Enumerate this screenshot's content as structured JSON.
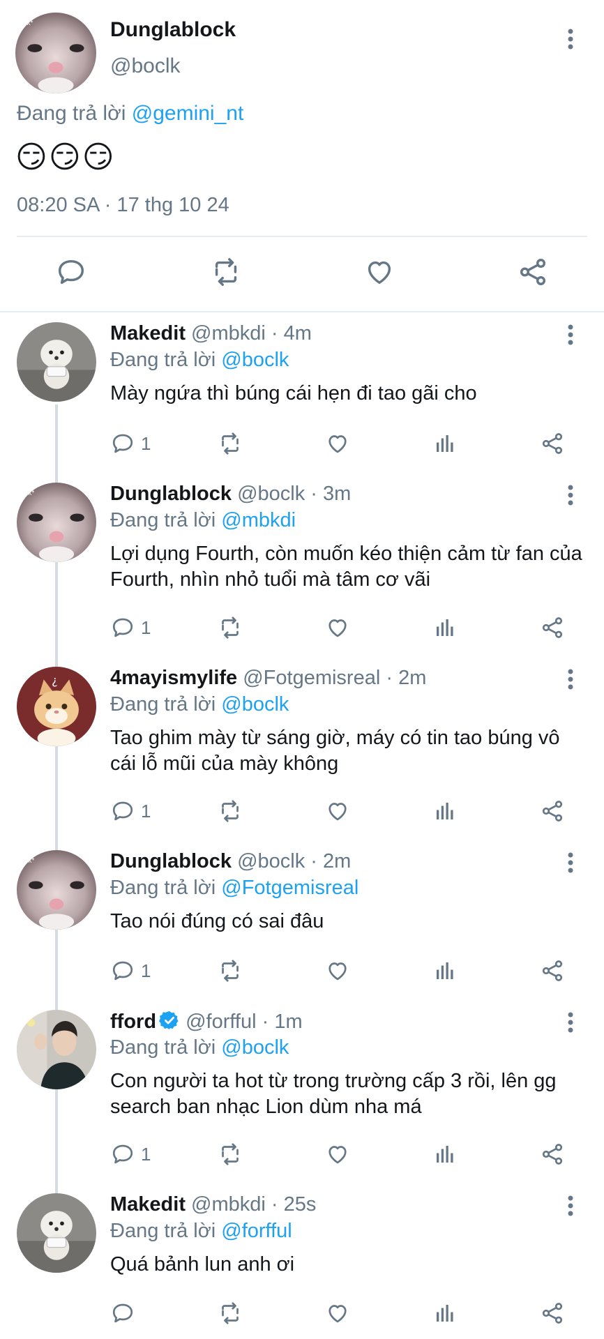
{
  "main_tweet": {
    "name": "Dunglablock",
    "handle": "@boclk",
    "replying_prefix": "Đang trả lời",
    "replying_to": "@gemini_nt",
    "text": "😏😏😏",
    "timestamp": "08:20 SA · 17 thg 10 24",
    "avatar": "cat-avatar",
    "avatar_label": "ock*"
  },
  "replies": [
    {
      "name": "Makedit",
      "handle": "@mbkdi",
      "time": "· 4m",
      "replying_prefix": "Đang trả lời",
      "replying_to": "@boclk",
      "text": "Mày ngứa thì búng cái hẹn đi tao gãi cho",
      "reply_count": "1",
      "avatar": "white-puppy-avatar",
      "verified": false
    },
    {
      "name": "Dunglablock",
      "handle": "@boclk",
      "time": "· 3m",
      "replying_prefix": "Đang trả lời",
      "replying_to": "@mbkdi",
      "text": "Lợi dụng Fourth, còn muốn kéo thiện cảm từ fan của Fourth, nhìn nhỏ tuổi mà tâm cơ vãi",
      "reply_count": "1",
      "avatar": "cat-avatar",
      "avatar_label": "ock*",
      "verified": false
    },
    {
      "name": "4mayismylife",
      "handle": "@Fotgemisreal",
      "time": "· 2m",
      "replying_prefix": "Đang trả lời",
      "replying_to": "@boclk",
      "text": "Tao ghim mày từ sáng giờ, máy có tin tao búng vô cái lỗ mũi của mày không",
      "reply_count": "1",
      "avatar": "orange-cat-avatar",
      "verified": false
    },
    {
      "name": "Dunglablock",
      "handle": "@boclk",
      "time": "· 2m",
      "replying_prefix": "Đang trả lời",
      "replying_to": "@Fotgemisreal",
      "text": "Tao nói đúng có sai đâu",
      "reply_count": "1",
      "avatar": "cat-avatar",
      "avatar_label": "ock*",
      "verified": false
    },
    {
      "name": "fford",
      "handle": "@forfful",
      "time": "· 1m",
      "replying_prefix": "Đang trả lời",
      "replying_to": "@boclk",
      "text": "Con người ta hot từ trong trường cấp 3 rồi, lên gg search ban nhạc Lion dùm nha má",
      "reply_count": "1",
      "avatar": "person-avatar",
      "verified": true
    },
    {
      "name": "Makedit",
      "handle": "@mbkdi",
      "time": "· 25s",
      "replying_prefix": "Đang trả lời",
      "replying_to": "@forfful",
      "text": "Quá bảnh lun anh ơi",
      "reply_count": "",
      "avatar": "white-puppy-avatar",
      "verified": false
    }
  ],
  "colors": {
    "link": "#1da1f2",
    "muted": "#657786",
    "icon": "#657786",
    "verified": "#1da1f2",
    "divider": "#e6ecf0"
  },
  "icons": [
    "reply-icon",
    "retweet-icon",
    "like-icon",
    "views-icon",
    "share-icon",
    "more-options-icon",
    "verified-badge-icon"
  ]
}
